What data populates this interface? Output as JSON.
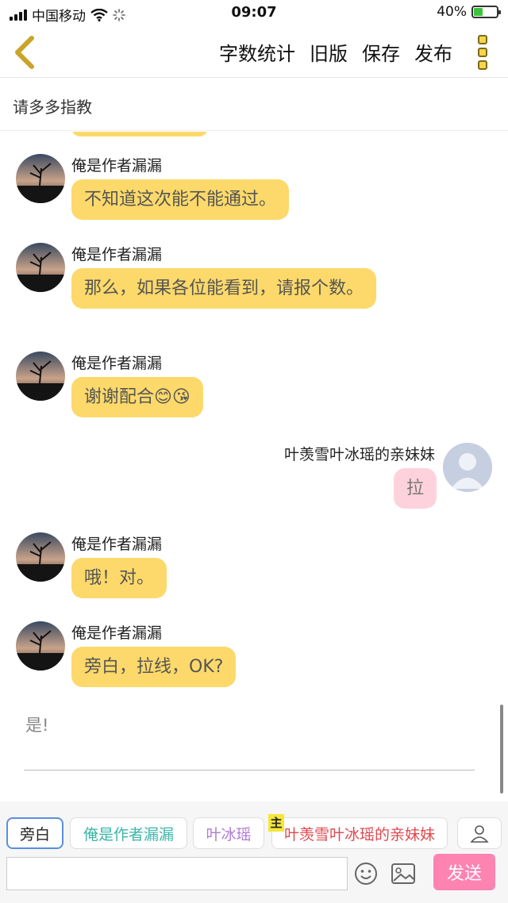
{
  "status_bar": {
    "carrier": "中国移动",
    "time": "09:07",
    "battery": "40%",
    "battery_level": 0.4,
    "icons": [
      "signal-icon",
      "wifi-icon",
      "loading-icon",
      "battery-icon"
    ]
  },
  "nav": {
    "back_icon": "chevron-left-icon",
    "actions": [
      "字数统计",
      "旧版",
      "保存",
      "发布"
    ],
    "more_icon": "more-vertical-icon"
  },
  "title": "请多多指教",
  "messages": [
    {
      "side": "left",
      "sender": "俺是作者漏漏",
      "text": "不知道这次能不能通过。"
    },
    {
      "side": "left",
      "sender": "俺是作者漏漏",
      "text": "那么，如果各位能看到，请报个数。"
    },
    {
      "side": "left",
      "sender": "俺是作者漏漏",
      "text": "谢谢配合😊😘"
    },
    {
      "side": "right",
      "sender": "叶羡雪叶冰瑶的亲妹妹",
      "text": "拉"
    },
    {
      "side": "left",
      "sender": "俺是作者漏漏",
      "text": "哦！对。"
    },
    {
      "side": "left",
      "sender": "俺是作者漏漏",
      "text": "旁白，拉线，OK?"
    }
  ],
  "narration": "是!",
  "roles": {
    "narrator": "旁白",
    "author": "俺是作者漏漏",
    "ice": "叶冰瑶",
    "host_badge": "主",
    "sister": "叶羡雪叶冰瑶的亲妹妹",
    "add_icon": "user-icon"
  },
  "input": {
    "value": "",
    "emoji_icon": "smiley-icon",
    "image_icon": "image-icon",
    "send_label": "发送"
  },
  "colors": {
    "bubble_left": "#fcd96a",
    "bubble_right": "#fdd2dc",
    "send": "#ff6fa5",
    "role_author": "#3bb5a7",
    "role_ice": "#b07ad6",
    "role_sister": "#e0484e"
  }
}
